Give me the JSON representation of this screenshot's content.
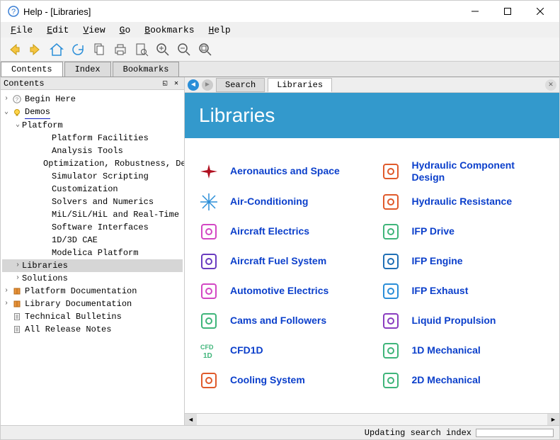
{
  "window": {
    "title": "Help - [Libraries]",
    "menu": [
      "File",
      "Edit",
      "View",
      "Go",
      "Bookmarks",
      "Help"
    ]
  },
  "toolbar_icons": [
    "back-icon",
    "forward-icon",
    "home-icon",
    "refresh-icon",
    "copy-icon",
    "print-icon",
    "find-in-page-icon",
    "zoom-in-icon",
    "zoom-out-icon",
    "zoom-reset-icon"
  ],
  "left_tabs": [
    {
      "label": "Contents",
      "active": true
    },
    {
      "label": "Index",
      "active": false
    },
    {
      "label": "Bookmarks",
      "active": false
    }
  ],
  "sidebar": {
    "header": "Contents",
    "tree": [
      {
        "depth": 0,
        "toggle": ">",
        "icon": "question",
        "label": "Begin Here"
      },
      {
        "depth": 0,
        "toggle": "v",
        "icon": "bulb",
        "label": "Demos",
        "underlined": true
      },
      {
        "depth": 1,
        "toggle": "v",
        "icon": "",
        "label": "Platform"
      },
      {
        "depth": 3,
        "toggle": "",
        "icon": "",
        "label": "Platform Facilities"
      },
      {
        "depth": 3,
        "toggle": "",
        "icon": "",
        "label": "Analysis Tools"
      },
      {
        "depth": 3,
        "toggle": "",
        "icon": "",
        "label": "Optimization, Robustness, Des…"
      },
      {
        "depth": 3,
        "toggle": "",
        "icon": "",
        "label": "Simulator Scripting"
      },
      {
        "depth": 3,
        "toggle": "",
        "icon": "",
        "label": "Customization"
      },
      {
        "depth": 3,
        "toggle": "",
        "icon": "",
        "label": "Solvers and Numerics"
      },
      {
        "depth": 3,
        "toggle": "",
        "icon": "",
        "label": "MiL/SiL/HiL and Real-Time"
      },
      {
        "depth": 3,
        "toggle": "",
        "icon": "",
        "label": "Software Interfaces"
      },
      {
        "depth": 3,
        "toggle": "",
        "icon": "",
        "label": "1D/3D CAE"
      },
      {
        "depth": 3,
        "toggle": "",
        "icon": "",
        "label": "Modelica Platform"
      },
      {
        "depth": 1,
        "toggle": ">",
        "icon": "",
        "label": "Libraries",
        "selected": true
      },
      {
        "depth": 1,
        "toggle": ">",
        "icon": "",
        "label": "Solutions"
      },
      {
        "depth": 0,
        "toggle": ">",
        "icon": "book-orange",
        "label": "Platform Documentation"
      },
      {
        "depth": 0,
        "toggle": ">",
        "icon": "book-orange",
        "label": "Library Documentation"
      },
      {
        "depth": 0,
        "toggle": "",
        "icon": "page",
        "label": "Technical Bulletins"
      },
      {
        "depth": 0,
        "toggle": "",
        "icon": "page",
        "label": "All Release Notes"
      }
    ]
  },
  "main_tabs": [
    {
      "label": "Search",
      "active": false
    },
    {
      "label": "Libraries",
      "active": true
    }
  ],
  "page": {
    "title": "Libraries",
    "items": [
      {
        "label": "Aeronautics and Space",
        "icon": "airplane",
        "color": "#b01020"
      },
      {
        "label": "Hydraulic Component Design",
        "icon": "hyd-comp",
        "color": "#e05a2b"
      },
      {
        "label": "Air-Conditioning",
        "icon": "snowflake",
        "color": "#2a8ed8"
      },
      {
        "label": "Hydraulic Resistance",
        "icon": "hyd-res",
        "color": "#e05a2b"
      },
      {
        "label": "Aircraft Electrics",
        "icon": "elec",
        "color": "#d348c4"
      },
      {
        "label": "IFP Drive",
        "icon": "car-drive",
        "color": "#3fb57a"
      },
      {
        "label": "Aircraft Fuel System",
        "icon": "fuel",
        "color": "#6a3cc0"
      },
      {
        "label": "IFP Engine",
        "icon": "engine",
        "color": "#1f6fb5"
      },
      {
        "label": "Automotive Electrics",
        "icon": "auto-elec",
        "color": "#d348c4"
      },
      {
        "label": "IFP Exhaust",
        "icon": "exhaust",
        "color": "#2a8ed8"
      },
      {
        "label": "Cams and Followers",
        "icon": "cam",
        "color": "#3fb57a"
      },
      {
        "label": "Liquid Propulsion",
        "icon": "propulsion",
        "color": "#8a3cc0"
      },
      {
        "label": "CFD1D",
        "icon": "cfd",
        "color": "#3fb57a"
      },
      {
        "label": "1D Mechanical",
        "icon": "mech1d",
        "color": "#3fb57a"
      },
      {
        "label": "Cooling System",
        "icon": "cooling",
        "color": "#e05a2b"
      },
      {
        "label": "2D Mechanical",
        "icon": "mech2d",
        "color": "#3fb57a"
      }
    ]
  },
  "status": {
    "text": "Updating search index"
  }
}
